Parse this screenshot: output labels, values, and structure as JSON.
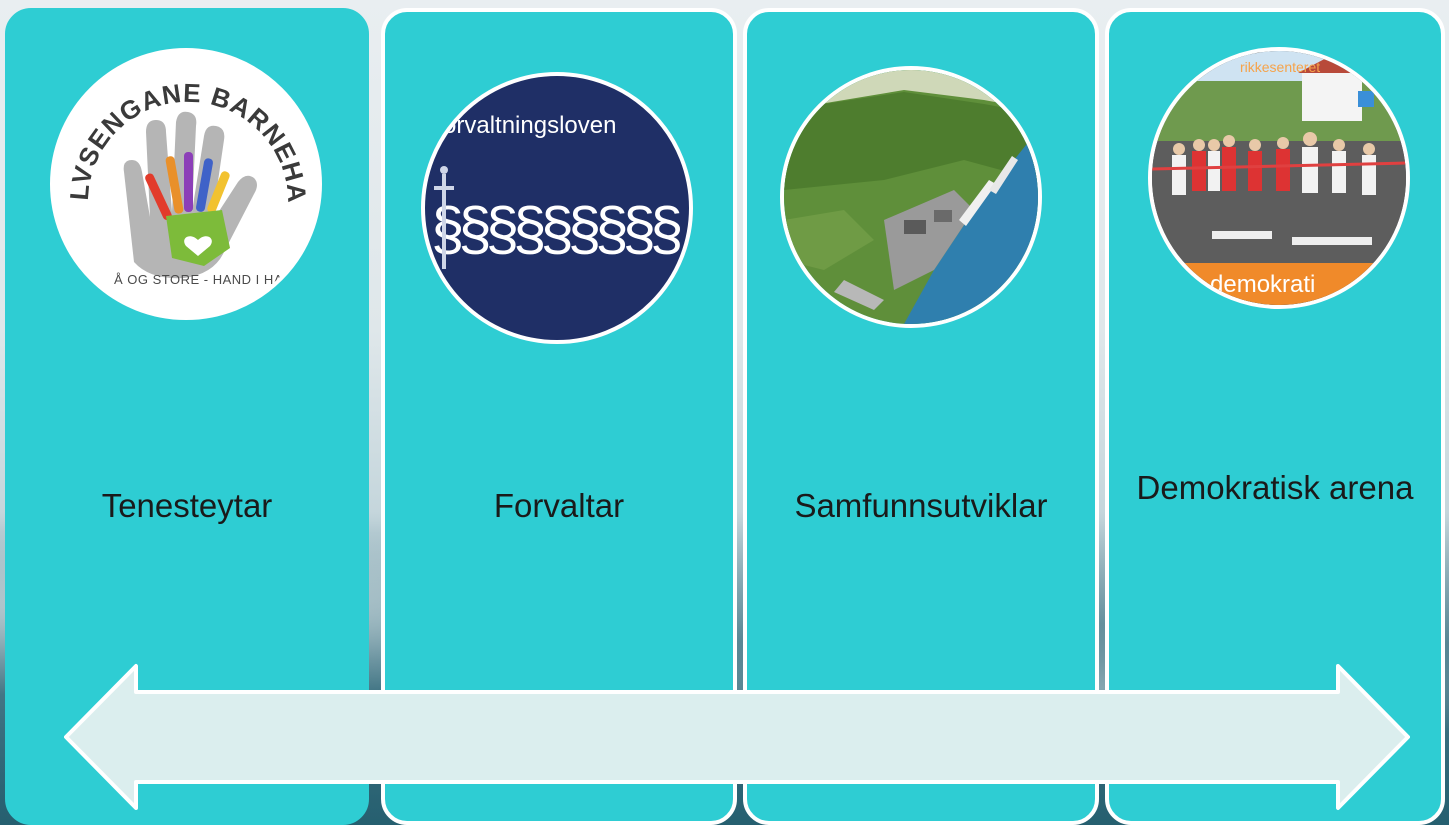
{
  "columns": [
    {
      "label": "Tenesteytar",
      "image": "kindergarten-logo",
      "image_text": {
        "arc": "GOLVSENGANE BARNEHAGE",
        "sub": "Å OG STORE - HAND I HA"
      }
    },
    {
      "label": "Forvaltar",
      "image": "administrative-law",
      "image_text": {
        "title": "orvaltningsloven",
        "symbols": "§§§§§§§§§"
      }
    },
    {
      "label": "Samfunnsutviklar",
      "image": "fjord-harbour-aerial"
    },
    {
      "label": "Demokratisk arena",
      "image": "ribbon-cutting-crowd",
      "image_text": {
        "top": "rikkesenteret",
        "banner": "demokrati"
      }
    }
  ],
  "arrow": {
    "type": "double-headed",
    "color": "#dbeeee"
  },
  "colors": {
    "column": "#2ecdd3",
    "border": "#ffffff"
  }
}
